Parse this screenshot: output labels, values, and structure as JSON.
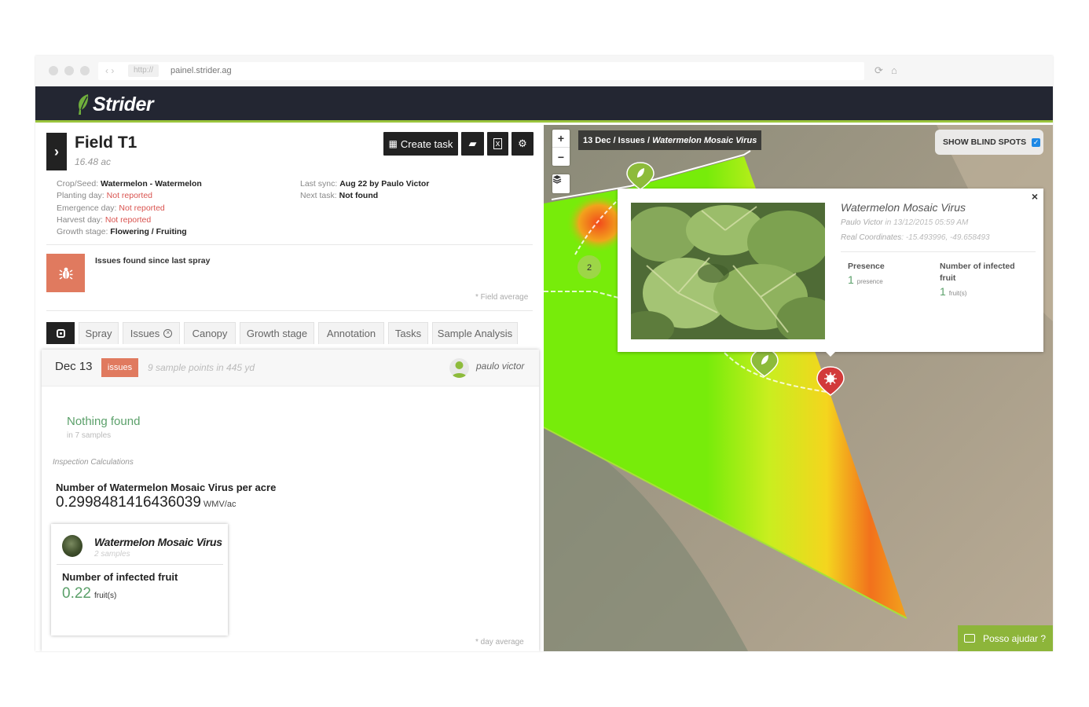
{
  "browser": {
    "url_protocol": "http://",
    "url": "painel.strider.ag",
    "nav_arrows": "‹  ›"
  },
  "app": {
    "brand": "Strider",
    "brand_color": "#232632",
    "accent_color": "#9ac43c"
  },
  "field": {
    "title": "Field T1",
    "area": "16.48 ac",
    "crop_label": "Crop/Seed:",
    "crop_value": "Watermelon - Watermelon",
    "planting_label": "Planting day:",
    "planting_value": "Not reported",
    "emergence_label": "Emergence day:",
    "emergence_value": "Not reported",
    "harvest_label": "Harvest day:",
    "harvest_value": "Not reported",
    "growth_label": "Growth stage:",
    "growth_value": "Flowering / Fruiting",
    "sync_label": "Last sync:",
    "sync_value": "Aug 22 by Paulo Victor",
    "next_task_label": "Next task:",
    "next_task_value": "Not found",
    "issues_found": "Issues found since last spray",
    "field_average": "* Field average"
  },
  "toolbar": {
    "create_task": "Create task"
  },
  "tabs": [
    "Spray",
    "Issues",
    "Canopy",
    "Growth stage",
    "Annotation",
    "Tasks",
    "Sample Analysis"
  ],
  "card": {
    "date": "Dec 13",
    "badge": "issues",
    "sample_points": "9 sample points in 445 yd",
    "user": "paulo victor",
    "nothing_found": "Nothing found",
    "in_samples": "in 7 samples",
    "inspection": "Inspection Calculations",
    "metric_title": "Number of Watermelon Mosaic Virus per acre",
    "metric_value": "0.2998481416436039",
    "metric_unit": "WMV/ac",
    "disease_name": "Watermelon Mosaic Virus",
    "disease_samples": "2 samples",
    "infected_title": "Number of infected fruit",
    "infected_value": "0.22",
    "infected_unit": "fruit(s)",
    "day_average": "* day average"
  },
  "map": {
    "zoom_in": "+",
    "zoom_out": "−",
    "breadcrumb_date": "13 Dec",
    "breadcrumb_sep1": " / ",
    "breadcrumb_issues": "Issues",
    "breadcrumb_sep2": " / ",
    "breadcrumb_disease": "Watermelon Mosaic Virus",
    "blind_spots": "SHOW BLIND SPOTS",
    "cluster_count": "2",
    "help": "Posso ajudar ?"
  },
  "popup": {
    "close": "×",
    "title": "Watermelon Mosaic Virus",
    "author": "Paulo Victor",
    "author_in": " in ",
    "datetime": "13/12/2015 05:59 AM",
    "coords_label": "Real Coordinates",
    "coords_value": ": -15.493996, -49.658493",
    "presence_label": "Presence",
    "presence_value": "1",
    "presence_unit": "presence",
    "infected_label_1": "Number of infected",
    "infected_label_2": "fruit",
    "infected_value": "1",
    "infected_unit": "fruit(s)"
  }
}
